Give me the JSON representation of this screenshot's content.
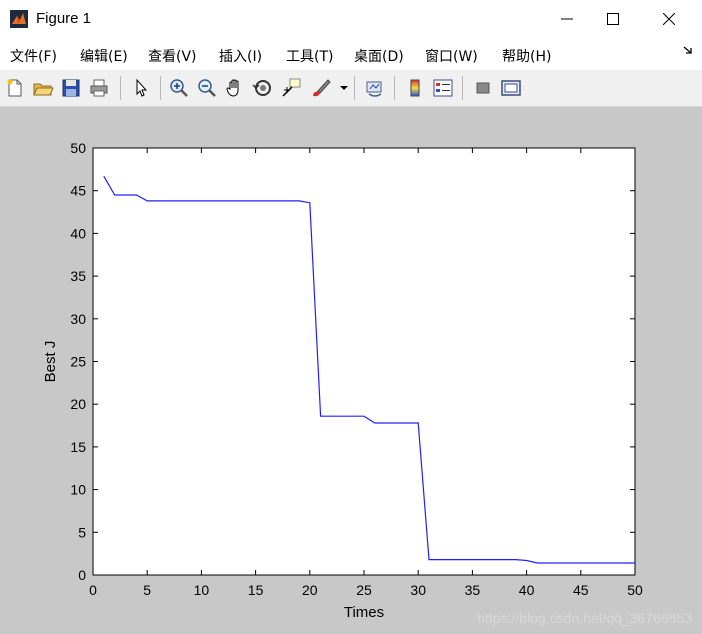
{
  "window": {
    "title": "Figure 1"
  },
  "menu": {
    "items": [
      {
        "label": "文件(F)"
      },
      {
        "label": "编辑(E)"
      },
      {
        "label": "查看(V)"
      },
      {
        "label": "插入(I)"
      },
      {
        "label": "工具(T)"
      },
      {
        "label": "桌面(D)"
      },
      {
        "label": "窗口(W)"
      },
      {
        "label": "帮助(H)"
      }
    ]
  },
  "toolbar": {
    "icons": [
      "new-figure-icon",
      "open-file-icon",
      "save-icon",
      "print-icon",
      "select-arrow-icon",
      "zoom-in-icon",
      "zoom-out-icon",
      "pan-hand-icon",
      "rotate-3d-icon",
      "data-cursor-icon",
      "brush-icon",
      "link-plot-icon",
      "colorbar-icon",
      "legend-icon",
      "hide-plot-tools-icon",
      "show-plot-tools-icon"
    ]
  },
  "chart_data": {
    "type": "line",
    "xlabel": "Times",
    "ylabel": "Best J",
    "xlim": [
      0,
      50
    ],
    "ylim": [
      0,
      50
    ],
    "xticks": [
      0,
      5,
      10,
      15,
      20,
      25,
      30,
      35,
      40,
      45,
      50
    ],
    "yticks": [
      0,
      5,
      10,
      15,
      20,
      25,
      30,
      35,
      40,
      45,
      50
    ],
    "grid": false,
    "color": "#2020ff",
    "series": [
      {
        "x": [
          1,
          2,
          4,
          5,
          19,
          20,
          21,
          25,
          26,
          30,
          31,
          39,
          40,
          41,
          50
        ],
        "y": [
          46.7,
          44.5,
          44.5,
          43.8,
          43.8,
          43.6,
          18.6,
          18.6,
          17.8,
          17.8,
          1.8,
          1.8,
          1.7,
          1.4,
          1.4
        ]
      }
    ]
  },
  "watermark": "https://blog.csdn.net/qq_36766853"
}
